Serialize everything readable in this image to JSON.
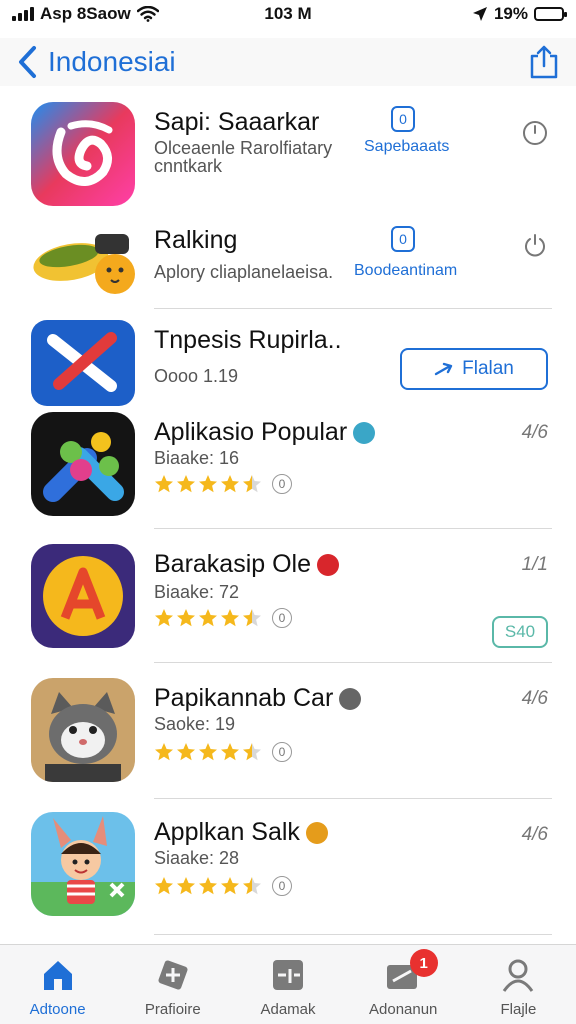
{
  "status": {
    "carrier": "Asp 8Saow",
    "time": "103 M",
    "battery": "19%",
    "battery_level": 0.19
  },
  "nav": {
    "title": "Indonesiai"
  },
  "colors": {
    "accent": "#1f6fd6",
    "star": "#f5b81c",
    "badge": "#e8312f",
    "price": "#5ab8a8"
  },
  "apps": [
    {
      "name": "Sapi: Saaarkar",
      "sub1": "Olceaenle Rarolfiatary",
      "sub2": "cnntkark",
      "link": "Sapebaaats",
      "icon": "social-app-icon",
      "right_icon": "clock-icon"
    },
    {
      "name": "Ralking",
      "sub1": "Aplory cliaplanelaeisa.",
      "link": "Boodeantinam",
      "icon": "food-app-icon",
      "right_icon": "power-icon"
    },
    {
      "name": "Tnpesis Rupirla..",
      "sub1": "Oooo 1.19",
      "action": "Flalan",
      "icon": "x-app-icon"
    },
    {
      "name": "Aplikasio Popular",
      "sub1": "Biaake: 16",
      "rank": "4/6",
      "rating": 4.5,
      "rating_count": "0",
      "icon": "puzzle-app-icon"
    },
    {
      "name": "Barakasip Ole",
      "sub1": "Biaake: 72",
      "rank": "1/1",
      "rating": 4.5,
      "rating_count": "0",
      "price": "S40",
      "icon": "letter-a-app-icon"
    },
    {
      "name": "Papikannab Car",
      "sub1": "Saoke: 19",
      "rank": "4/6",
      "rating": 4.5,
      "rating_count": "0",
      "icon": "cat-app-icon"
    },
    {
      "name": "Applkan Salk",
      "sub1": "Siaake: 28",
      "rank": "4/6",
      "rating": 4.5,
      "rating_count": "0",
      "icon": "kids-app-icon"
    }
  ],
  "tabs": [
    {
      "label": "Adtoone",
      "icon": "home-icon",
      "active": true
    },
    {
      "label": "Prafioire",
      "icon": "apps-icon"
    },
    {
      "label": "Adamak",
      "icon": "games-icon"
    },
    {
      "label": "Adonanun",
      "icon": "updates-icon",
      "badge": "1"
    },
    {
      "label": "Flajle",
      "icon": "profile-icon"
    }
  ]
}
